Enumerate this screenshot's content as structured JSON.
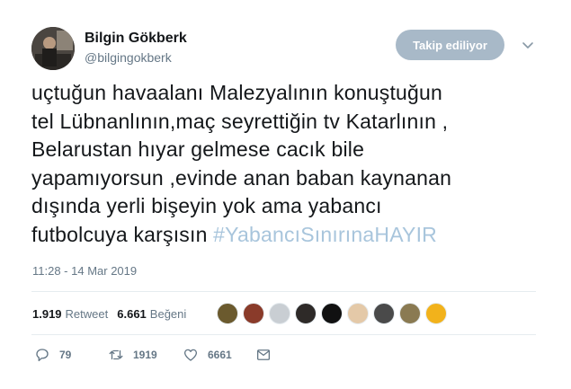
{
  "user": {
    "name": "Bilgin Gökberk",
    "handle": "@bilgingokberk"
  },
  "follow_button": "Takip ediliyor",
  "tweet": {
    "lines": [
      "uçtuğun havaalanı Malezyalının konuştuğun",
      "tel Lübnanlının,maç seyrettiğin tv Katarlının ,",
      "Belarustan hıyar gelmese cacık bile",
      "yapamıyorsun ,evinde  anan baban kaynanan",
      "dışında yerli bişeyin yok ama yabancı",
      "futbolcuya karşısın"
    ],
    "hashtag": "#YabancıSınırınaHAYIR",
    "timestamp": "11:28 - 14 Mar 2019"
  },
  "stats": {
    "retweets_count": "1.919",
    "retweets_label": "Retweet",
    "likes_count": "6.661",
    "likes_label": "Beğeni"
  },
  "liker_avatars": [
    "#6b5a2e",
    "#8a3b2a",
    "#c9ced3",
    "#2e2a28",
    "#111111",
    "#e4c9a8",
    "#4a4a4a",
    "#8a7a52",
    "#f2b21b"
  ],
  "actions": {
    "replies": "79",
    "retweets": "1919",
    "likes": "6661"
  }
}
